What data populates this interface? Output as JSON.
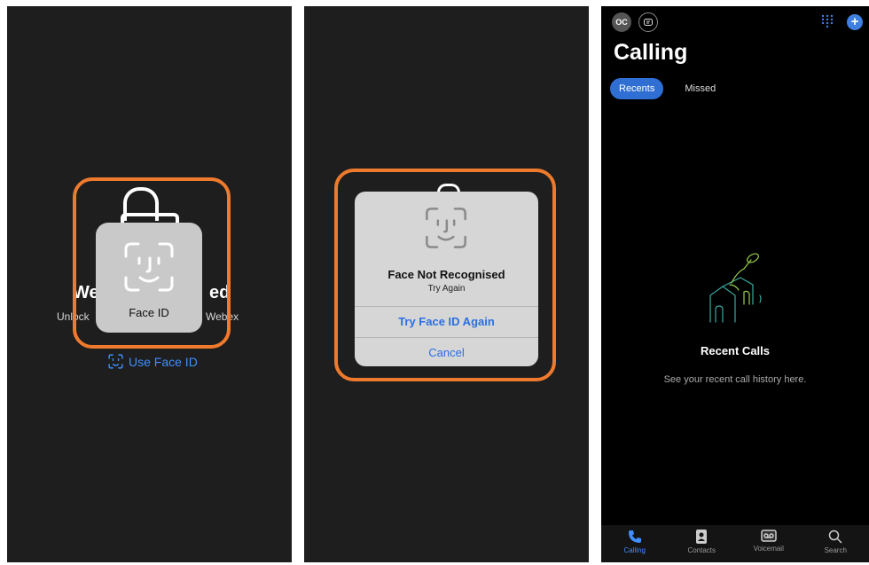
{
  "panel1": {
    "bg_title_left": "We",
    "bg_title_right": "ed",
    "bg_sub_left": "Unlock",
    "bg_sub_right": "Webex",
    "hud_label": "Face ID",
    "use_face_id": "Use Face ID"
  },
  "panel2": {
    "alert_title": "Face Not Recognised",
    "alert_subtitle": "Try Again",
    "try_again": "Try Face ID Again",
    "cancel": "Cancel"
  },
  "panel3": {
    "avatar_initials": "OC",
    "title": "Calling",
    "tabs": [
      {
        "label": "Recents",
        "active": true
      },
      {
        "label": "Missed",
        "active": false
      }
    ],
    "empty_title": "Recent Calls",
    "empty_subtitle": "See your recent call history here.",
    "nav": [
      {
        "label": "Calling",
        "icon": "phone-icon",
        "active": true
      },
      {
        "label": "Contacts",
        "icon": "contacts-icon",
        "active": false
      },
      {
        "label": "Voicemail",
        "icon": "voicemail-icon",
        "active": false
      },
      {
        "label": "Search",
        "icon": "search-icon",
        "active": false
      }
    ]
  },
  "colors": {
    "highlight": "#ee7a2d",
    "accent": "#3f8fff",
    "tab_active": "#2f6fd4"
  }
}
